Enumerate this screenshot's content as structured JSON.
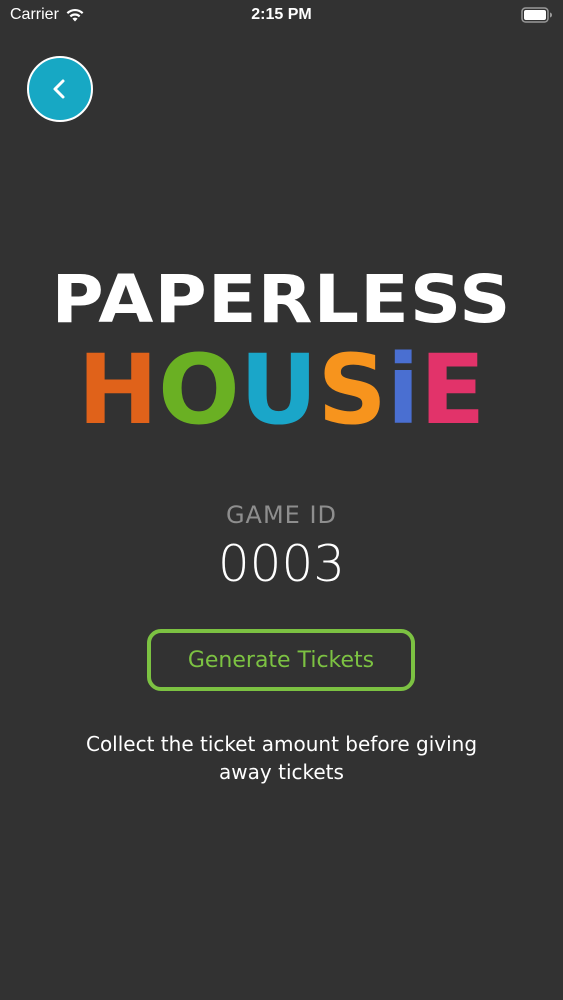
{
  "status_bar": {
    "carrier": "Carrier",
    "time": "2:15 PM",
    "wifi_icon": "wifi-icon",
    "battery_icon": "battery-icon"
  },
  "back_button": {
    "icon": "chevron-left-icon",
    "color": "#17a8c4"
  },
  "logo": {
    "line1": "PAPERLESS",
    "line2_letters": [
      {
        "char": "H",
        "color": "#e0621a"
      },
      {
        "char": "O",
        "color": "#6ab023"
      },
      {
        "char": "U",
        "color": "#1aa6c9"
      },
      {
        "char": "S",
        "color": "#f7941d"
      },
      {
        "char": "i",
        "color": "#4a6fd1"
      },
      {
        "char": "E",
        "color": "#e2336a"
      }
    ]
  },
  "game": {
    "label": "GAME ID",
    "id": "0003"
  },
  "generate_button": {
    "label": "Generate Tickets",
    "color": "#7cc242"
  },
  "note": "Collect the ticket amount before giving away tickets"
}
